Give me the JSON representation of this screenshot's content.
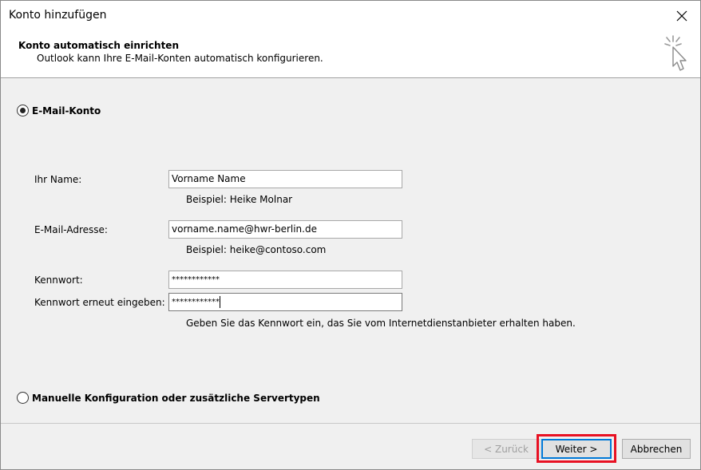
{
  "window": {
    "title": "Konto hinzufügen",
    "close_glyph": "✕"
  },
  "header": {
    "title": "Konto automatisch einrichten",
    "subtitle": "Outlook kann Ihre E-Mail-Konten automatisch konfigurieren.",
    "icon": "wizard-cursor-icon"
  },
  "options": {
    "email_account": {
      "label": "E-Mail-Konto",
      "selected": true
    },
    "manual": {
      "label": "Manuelle Konfiguration oder zusätzliche Servertypen",
      "selected": false
    }
  },
  "form": {
    "name": {
      "label": "Ihr Name:",
      "value": "Vorname Name",
      "hint": "Beispiel: Heike Molnar"
    },
    "email": {
      "label": "E-Mail-Adresse:",
      "value": "vorname.name@hwr-berlin.de",
      "hint": "Beispiel: heike@contoso.com"
    },
    "password": {
      "label": "Kennwort:",
      "value": "************"
    },
    "password_repeat": {
      "label": "Kennwort erneut eingeben:",
      "value": "************"
    },
    "password_hint": "Geben Sie das Kennwort ein, das Sie vom Internetdienstanbieter erhalten haben."
  },
  "buttons": {
    "back": "< Zurück",
    "next": "Weiter >",
    "cancel": "Abbrechen"
  },
  "colors": {
    "highlight": "#e81123",
    "focus": "#0078d7"
  }
}
